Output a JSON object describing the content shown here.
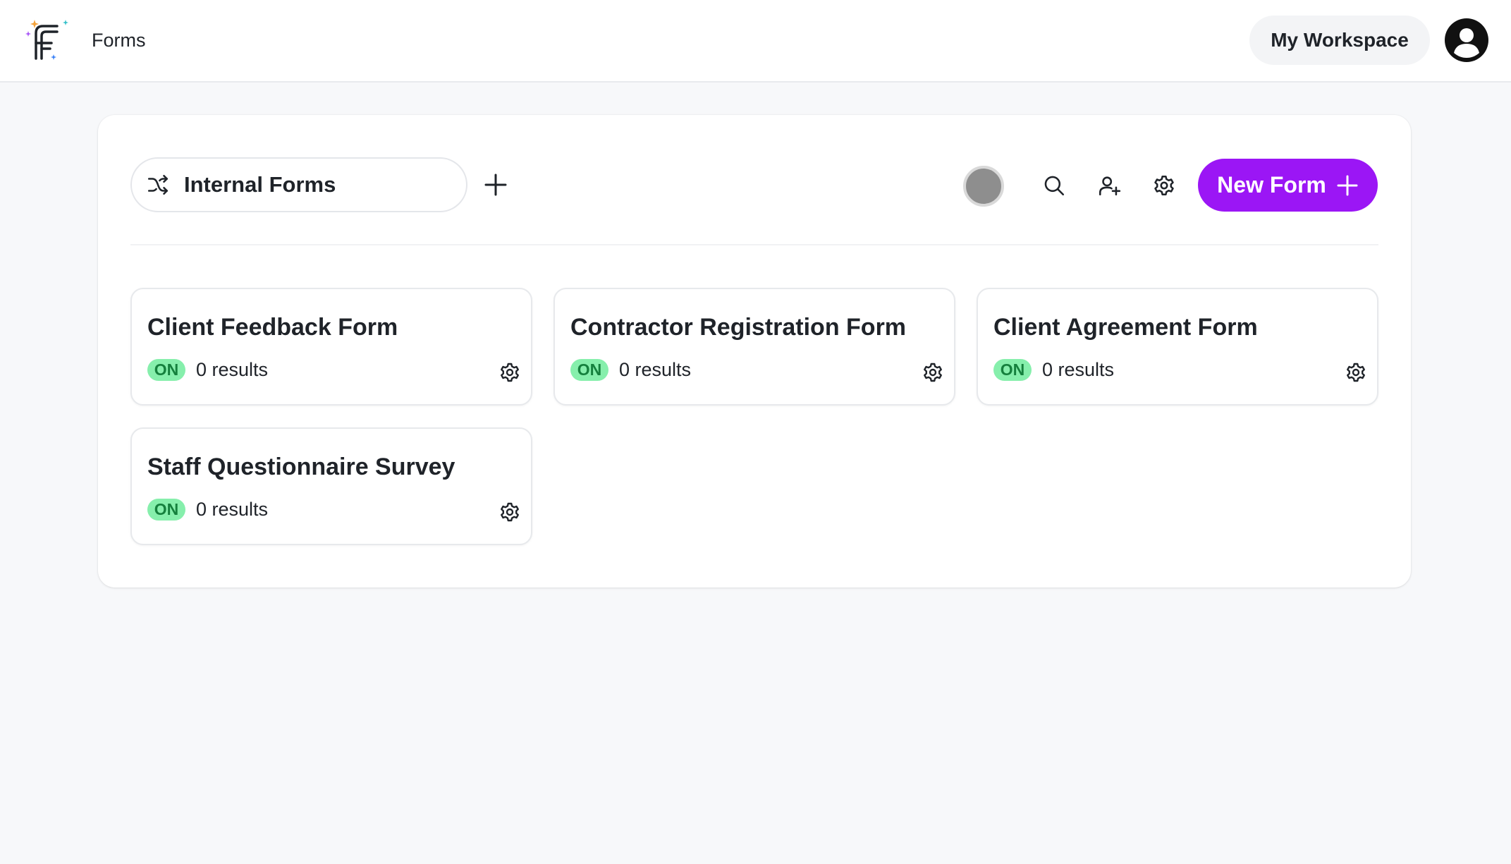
{
  "header": {
    "app_name": "Forms",
    "workspace_button": "My Workspace",
    "logo_icon": "forms-logo-icon",
    "account_icon": "user-circle-icon"
  },
  "toolbar": {
    "workspace_name": "Internal Forms",
    "workspace_icon": "shuffle-icon",
    "add_icon": "plus-icon",
    "status_color": "#8e8e8e",
    "icons": [
      "search-icon",
      "user-plus-icon",
      "gear-icon"
    ],
    "new_form_label": "New Form",
    "accent_color": "#9b16f5"
  },
  "forms": [
    {
      "title": "Client Feedback Form",
      "status": "ON",
      "results": "0 results"
    },
    {
      "title": "Contractor Registration Form",
      "status": "ON",
      "results": "0 results"
    },
    {
      "title": "Client Agreement Form",
      "status": "ON",
      "results": "0 results"
    },
    {
      "title": "Staff Questionnaire Survey",
      "status": "ON",
      "results": "0 results"
    }
  ],
  "colors": {
    "badge_bg": "#86efac",
    "badge_text": "#15803d",
    "page_bg": "#f7f8fa"
  }
}
